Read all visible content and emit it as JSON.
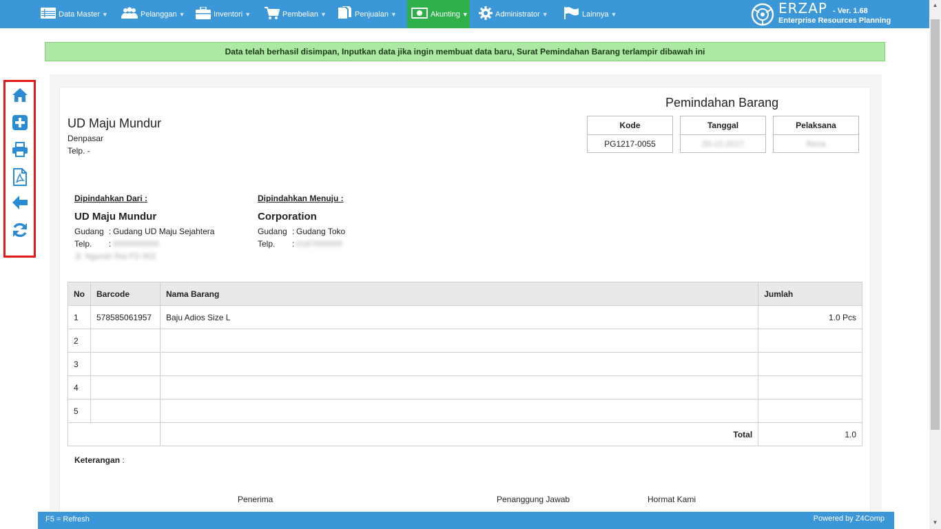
{
  "nav": {
    "items": [
      {
        "label": "Data Master",
        "icon": "table-icon"
      },
      {
        "label": "Pelanggan",
        "icon": "users-icon"
      },
      {
        "label": "Inventori",
        "icon": "briefcase-icon"
      },
      {
        "label": "Pembelian",
        "icon": "cart-icon"
      },
      {
        "label": "Penjualan",
        "icon": "document-icon"
      },
      {
        "label": "Akunting",
        "icon": "money-icon"
      },
      {
        "label": "Administrator",
        "icon": "gear-icon"
      },
      {
        "label": "Lainnya",
        "icon": "flag-icon"
      }
    ],
    "active": "Akunting"
  },
  "brand": {
    "name": "ERZAP",
    "version": "- Ver. 1.68",
    "subtitle": "Enterprise Resources Planning"
  },
  "alert": {
    "message": "Data telah berhasil disimpan, Inputkan data jika ingin membuat data baru, Surat Pemindahan Barang terlampir dibawah ini"
  },
  "toolbar": {
    "tools": [
      "home-icon",
      "add-icon",
      "print-icon",
      "pdf-icon",
      "back-icon",
      "refresh-icon"
    ]
  },
  "document": {
    "title": "Pemindahan Barang",
    "company": {
      "name": "UD Maju Mundur",
      "city": "Denpasar",
      "phone": "Telp. -"
    },
    "header": {
      "kode_label": "Kode",
      "kode_value": "PG1217-0055",
      "tanggal_label": "Tanggal",
      "tanggal_value": "20-12-2017",
      "pelaksana_label": "Pelaksana",
      "pelaksana_value": "Reza"
    },
    "from": {
      "label": "Dipindahkan Dari :",
      "name": "UD Maju Mundur",
      "gudang_key": "Gudang",
      "gudang_value": "Gudang UD Maju Sejahtera",
      "telp_key": "Telp.",
      "telp_value": "0000000000",
      "address": "Jl. Ngurah Rai FD 002"
    },
    "to": {
      "label": "Dipindahkan Menuju :",
      "name": "Corporation",
      "gudang_key": "Gudang",
      "gudang_value": "Gudang Toko",
      "telp_key": "Telp.",
      "telp_value": "0187000000"
    },
    "table": {
      "headers": {
        "no": "No",
        "barcode": "Barcode",
        "nama": "Nama Barang",
        "jumlah": "Jumlah"
      },
      "rows": [
        {
          "no": "1",
          "barcode": "578585061957",
          "nama": "Baju Adios Size L",
          "jumlah": "1.0 Pcs"
        },
        {
          "no": "2",
          "barcode": "",
          "nama": "",
          "jumlah": ""
        },
        {
          "no": "3",
          "barcode": "",
          "nama": "",
          "jumlah": ""
        },
        {
          "no": "4",
          "barcode": "",
          "nama": "",
          "jumlah": ""
        },
        {
          "no": "5",
          "barcode": "",
          "nama": "",
          "jumlah": ""
        }
      ],
      "total_label": "Total",
      "total_value": "1.0"
    },
    "keterangan_label": "Keterangan",
    "keterangan_colon": ":",
    "signatures": {
      "penerima": "Penerima",
      "penanggung": "Penanggung Jawab",
      "hormat": "Hormat Kami"
    }
  },
  "footer": {
    "left": "F5 = Refresh",
    "right": "Powered by Z4Comp"
  },
  "colors": {
    "nav_bg": "#3b97d8",
    "active_bg": "#2fb14a",
    "alert_bg": "#aee8a5",
    "toolbar_border": "#e21a1a",
    "icon_blue": "#2a8ad2"
  }
}
